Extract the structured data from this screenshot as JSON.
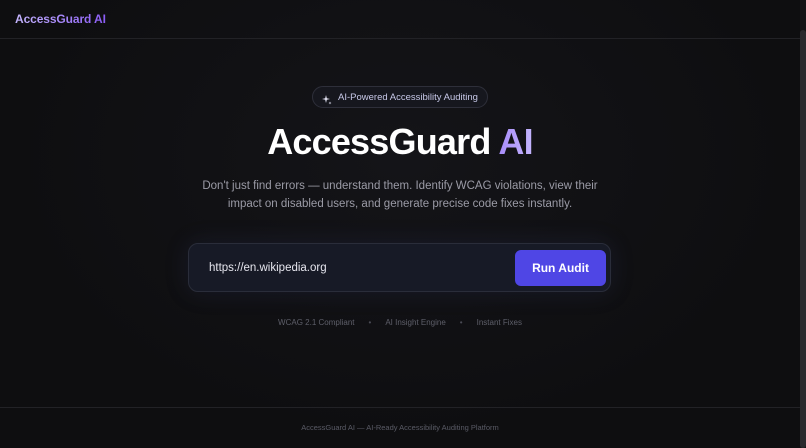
{
  "navbar": {
    "brand": "AccessGuard AI"
  },
  "hero": {
    "badge_icon": "sparkle-icon",
    "badge_text": "AI-Powered Accessibility Auditing",
    "title_main": "AccessGuard",
    "title_accent": "AI",
    "subtitle": "Don't just find errors — understand them. Identify WCAG violations, view their impact on disabled users, and generate precise code fixes instantly."
  },
  "audit": {
    "url_value": "https://en.wikipedia.org",
    "button_label": "Run Audit"
  },
  "features": {
    "items": [
      "WCAG 2.1 Compliant",
      "AI Insight Engine",
      "Instant Fixes"
    ],
    "separator": "•"
  },
  "footer": {
    "text": "AccessGuard AI — AI-Ready Accessibility Auditing Platform"
  },
  "colors": {
    "background": "#0f0f11",
    "accent": "#4f46e5",
    "brand_gradient_start": "#c4b5fd",
    "brand_gradient_end": "#8b5cf6"
  }
}
